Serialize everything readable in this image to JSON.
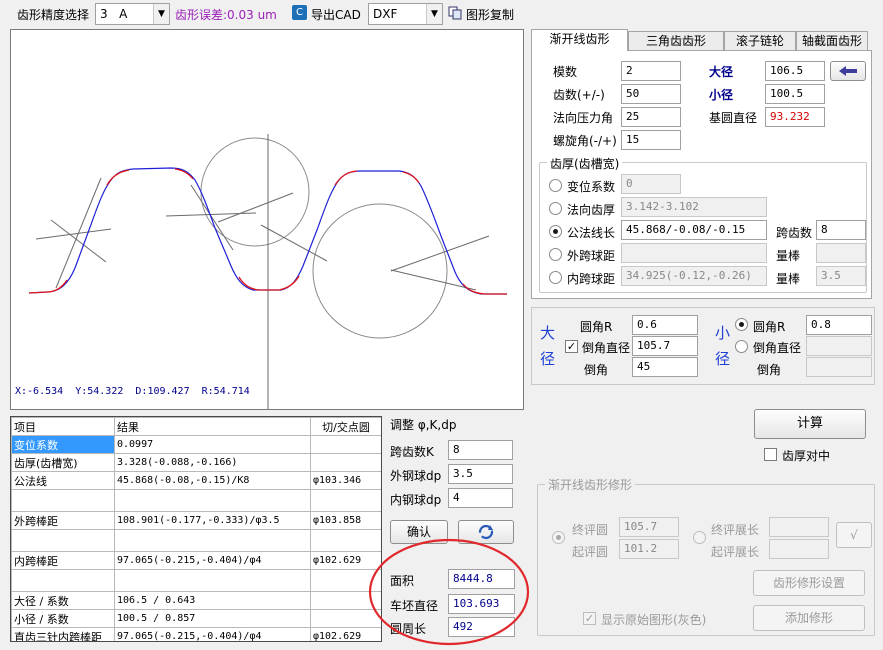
{
  "toolbar": {
    "precision_label": "齿形精度选择",
    "precision_value": "3   A",
    "error_label": "齿形误差:0.03 um",
    "export_cad_label": "导出CAD",
    "format_value": "DXF",
    "copy_label": "图形复制"
  },
  "canvas": {
    "status": "X:-6.534  Y:54.322  D:109.427  R:54.714"
  },
  "results_table": {
    "headers": [
      "项目",
      "结果",
      "切/交点圆"
    ],
    "rows": [
      {
        "item": "变位系数",
        "value": "0.0997",
        "circle": ""
      },
      {
        "item": "齿厚(齿槽宽)",
        "value": "3.328(-0.088,-0.166)",
        "circle": ""
      },
      {
        "item": "公法线",
        "value": "45.868(-0.08,-0.15)/K8",
        "circle": "φ103.346"
      },
      {
        "item": "",
        "value": "",
        "circle": ""
      },
      {
        "item": "外跨棒距",
        "value": "108.901(-0.177,-0.333)/φ3.5",
        "circle": "φ103.858"
      },
      {
        "item": "",
        "value": "",
        "circle": ""
      },
      {
        "item": "内跨棒距",
        "value": "97.065(-0.215,-0.404)/φ4",
        "circle": "φ102.629"
      },
      {
        "item": "",
        "value": "",
        "circle": ""
      },
      {
        "item": "大径 / 系数",
        "value": "106.5 / 0.643",
        "circle": ""
      },
      {
        "item": "小径 / 系数",
        "value": "100.5 / 0.857",
        "circle": ""
      },
      {
        "item": "直齿三针内跨棒距",
        "value": "97.065(-0.215,-0.404)/φ4",
        "circle": "φ102.629"
      }
    ]
  },
  "adjust": {
    "title": "调整 φ,K,dp",
    "k_label": "跨齿数K",
    "k_value": "8",
    "outer_label": "外钢球dp",
    "outer_value": "3.5",
    "inner_label": "内钢球dp",
    "inner_value": "4",
    "confirm_label": "确认",
    "area_label": "面积",
    "area_value": "8444.8",
    "blank_label": "车坯直径",
    "blank_value": "103.693",
    "perimeter_label": "圆周长",
    "perimeter_value": "492"
  },
  "tabs": [
    "渐开线齿形",
    "三角齿齿形",
    "滚子链轮",
    "轴截面齿形"
  ],
  "params": {
    "module_label": "模数",
    "module_value": "2",
    "teeth_label": "齿数(+/-)",
    "teeth_value": "50",
    "pressure_label": "法向压力角",
    "pressure_value": "25",
    "helix_label": "螺旋角(-/+)",
    "helix_value": "15",
    "major_label": "大径",
    "major_value": "106.5",
    "minor_label": "小径",
    "minor_value": "100.5",
    "base_label": "基圆直径",
    "base_value": "93.232"
  },
  "thickness": {
    "title": "齿厚(齿槽宽)",
    "opt1_label": "变位系数",
    "opt1_value": "0",
    "opt2_label": "法向齿厚",
    "opt2_value": "3.142-3.102",
    "opt3_label": "公法线长",
    "opt3_value": "45.868/-0.08/-0.15",
    "span_label": "跨齿数",
    "span_value": "8",
    "opt4_label": "外跨球距",
    "opt4_value": "",
    "opt4_rod_label": "量棒",
    "opt4_rod_value": "",
    "opt5_label": "内跨球距",
    "opt5_value": "34.925(-0.12,-0.26)",
    "opt5_rod_label": "量棒",
    "opt5_rod_value": "3.5"
  },
  "fillet": {
    "big_chars": [
      "大",
      "径"
    ],
    "big_r_label": "圆角R",
    "big_r_value": "0.6",
    "big_chamfer_label": "倒角直径",
    "big_chamfer_value": "105.7",
    "big_angle_label": "倒角",
    "big_angle_value": "45",
    "small_chars": [
      "小",
      "径"
    ],
    "small_r_label": "圆角R",
    "small_r_value": "0.8",
    "small_chamfer_label": "倒角直径",
    "small_chamfer_value": "",
    "small_angle_label": "倒角",
    "small_angle_value": ""
  },
  "actions": {
    "calc_label": "计算",
    "align_label": "齿厚对中"
  },
  "modify": {
    "title": "渐开线齿形修形",
    "end_circle_label": "终评圆",
    "end_circle_value": "105.7",
    "start_circle_label": "起评圆",
    "start_circle_value": "101.2",
    "end_len_label": "终评展长",
    "end_len_value": "",
    "start_len_label": "起评展长",
    "start_len_value": "",
    "check_glyph": "√",
    "setting_label": "齿形修形设置",
    "show_orig_label": "显示原始图形(灰色)",
    "add_label": "添加修形"
  },
  "colors": {
    "purple": "#9b1fb8",
    "navy": "#00008b",
    "red": "#d40000",
    "blue_curve": "#1f1fd6",
    "red_curve": "#e01818",
    "selected": "#3399ff",
    "annotation": "#e0282c"
  },
  "icons": {
    "export_cad": "cad-export-icon",
    "copy": "copy-icon",
    "refresh": "refresh-icon",
    "arrow": "left-arrow-icon"
  }
}
